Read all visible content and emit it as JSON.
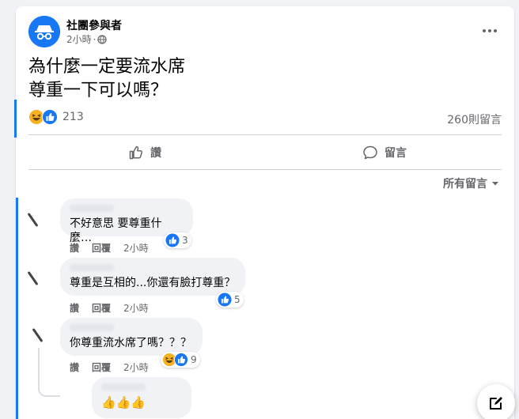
{
  "post": {
    "author": "社團參與者",
    "time": "2小時",
    "time_separator": "·",
    "audience_icon": "globe-icon",
    "lines": [
      "為什麼一定要流水席",
      "尊重一下可以嗎？"
    ],
    "reaction_count": "213",
    "comment_count": "260則留言",
    "reactions": [
      "haha",
      "like"
    ]
  },
  "actions": {
    "like_label": "讚",
    "comment_label": "留言"
  },
  "sort": {
    "label": "所有留言"
  },
  "comments": [
    {
      "text": "不好意思 要尊重什麼…",
      "like": "讚",
      "reply": "回覆",
      "time": "2小時",
      "reaction_count": "3",
      "reactions": [
        "like"
      ]
    },
    {
      "text": "尊重是互相的...你還有臉打尊重？",
      "like": "讚",
      "reply": "回覆",
      "time": "2小時",
      "reaction_count": "5",
      "reactions": [
        "like"
      ]
    },
    {
      "text": "你尊重流水席了嗎？？？",
      "like": "讚",
      "reply": "回覆",
      "time": "2小時",
      "reaction_count": "9",
      "reactions": [
        "haha",
        "like"
      ]
    },
    {
      "text": "👍👍👍"
    }
  ],
  "colors": {
    "brand": "#1877f2",
    "muted": "#65676b",
    "haha": "#f7b125"
  }
}
